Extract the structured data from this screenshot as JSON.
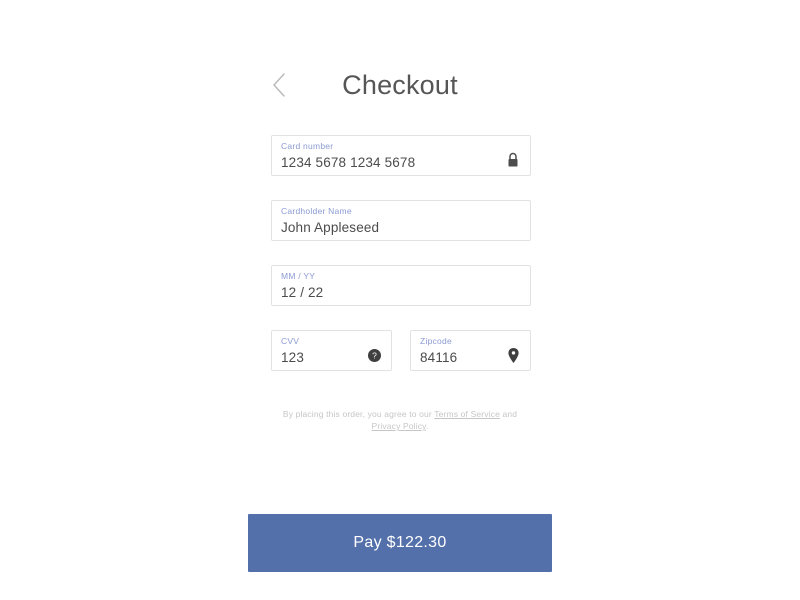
{
  "header": {
    "back_icon": "chevron-left-icon",
    "title": "Checkout"
  },
  "form": {
    "card_number": {
      "label": "Card number",
      "value": "1234 5678 1234 5678",
      "placeholder": "Card number",
      "icon": "lock-icon"
    },
    "cardholder_name": {
      "label": "Cardholder Name",
      "value": "John Appleseed",
      "placeholder": "Cardholder Name"
    },
    "expiry": {
      "label": "MM / YY",
      "value": "12 / 22",
      "placeholder": "MM / YY"
    },
    "cvv": {
      "label": "CVV",
      "value": "123",
      "placeholder": "CVV",
      "icon": "help-circle-icon"
    },
    "zipcode": {
      "label": "Zipcode",
      "value": "84116",
      "placeholder": "Zipcode",
      "icon": "map-pin-icon"
    }
  },
  "terms": {
    "prefix": "By placing this order, you agree to our ",
    "terms_link": "Terms of Service",
    "conjunction": " and ",
    "privacy_link": "Privacy Policy",
    "suffix": "."
  },
  "pay": {
    "label": "Pay $122.30",
    "amount": "$122.30",
    "color": "#5470ab"
  },
  "colors": {
    "background": "#ffffff",
    "field_border": "#e2e2e4",
    "field_label": "#8b9ad3",
    "field_value": "#4c4c4c",
    "title": "#565656",
    "terms_text": "#c6c6c8",
    "accent": "#5470ab"
  }
}
